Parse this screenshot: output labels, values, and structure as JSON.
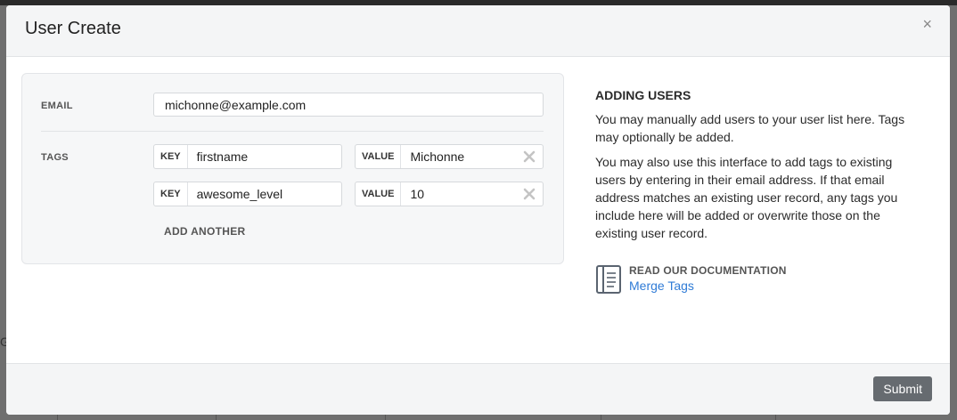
{
  "modal": {
    "title": "User Create",
    "close_label": "×"
  },
  "form": {
    "email_label": "EMAIL",
    "email_value": "michonne@example.com",
    "tags_label": "TAGS",
    "tags": [
      {
        "key_prefix": "KEY",
        "key": "firstname",
        "value_prefix": "VALUE",
        "value": "Michonne"
      },
      {
        "key_prefix": "KEY",
        "key": "awesome_level",
        "value_prefix": "VALUE",
        "value": "10"
      }
    ],
    "add_another_label": "ADD ANOTHER"
  },
  "sidebar": {
    "heading": "ADDING USERS",
    "paragraph_1": "You may manually add users to your user list here. Tags may optionally be added.",
    "paragraph_2": "You may also use this interface to add tags to existing users by entering in their email address. If that email address matches an existing user record, any tags you include here will be added or overwrite those on the existing user record.",
    "doc_label": "READ OUR DOCUMENTATION",
    "doc_link": "Merge Tags"
  },
  "footer": {
    "submit_label": "Submit"
  },
  "icons": {
    "close": "close-icon",
    "remove_tag": "x-icon",
    "documentation": "document-icon"
  },
  "colors": {
    "link": "#2f7bd6",
    "submit_bg": "#666b70",
    "header_bg": "#f4f5f6"
  }
}
